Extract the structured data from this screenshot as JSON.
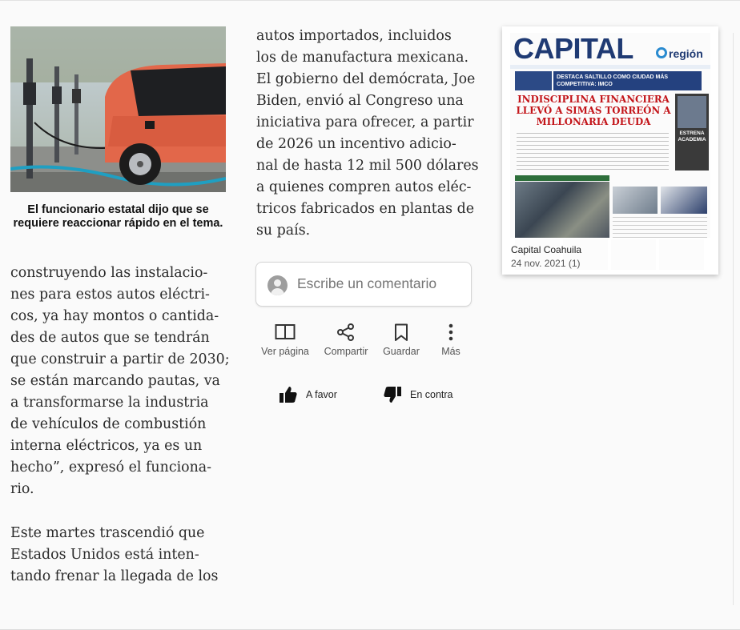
{
  "article": {
    "photo_caption": "El funcionario estatal dijo que se requiere reaccionar rápido en el tema.",
    "col1_para1": "construyendo las instalacio-\nnes para estos autos eléctri-\ncos, ya hay montos o cantida-\ndes de autos que se tendrán\nque construir a partir de 2030;\nse están marcando pautas, va\na transformarse la industria\nde vehículos de combustión\ninterna eléctricos, ya es un\nhecho”, expresó el funciona-\nrio.",
    "col1_para2": "Este martes trascendió que\nEstados Unidos está inten-\ntando frenar la llegada de los",
    "col2_para": "autos importados, incluidos\nlos de manufactura mexicana.\nEl gobierno del demócrata, Joe\nBiden, envió al Congreso una\niniciativa para ofrecer, a partir\nde 2026 un incentivo adicio-\nnal de hasta 12 mil 500 dólares\na quienes compren autos eléc-\ntricos fabricados en plantas de\nsu país."
  },
  "comment": {
    "placeholder": "Escribe un comentario"
  },
  "actions": {
    "view_page": "Ver página",
    "share": "Compartir",
    "save": "Guardar",
    "more": "Más",
    "vote_up": "A favor",
    "vote_down": "En contra"
  },
  "publication": {
    "name": "Capital Coahuila",
    "date": "24 nov. 2021  (1)",
    "masthead": "CAPITAL",
    "region_tag": "región",
    "sub_banner": "DESTACA SALTILLO COMO CIUDAD MÁS COMPETITIVA: IMCO",
    "headline": "INDISCIPLINA FINANCIERA LLEVÓ A SIMAS TORREÓN A MILLONARIA DEUDA",
    "side_label": "ESTRENA ACADEMIA"
  },
  "colors": {
    "masthead_blue": "#1f3a73",
    "headline_red": "#c3151a",
    "text_gray": "#2a2a2a"
  }
}
